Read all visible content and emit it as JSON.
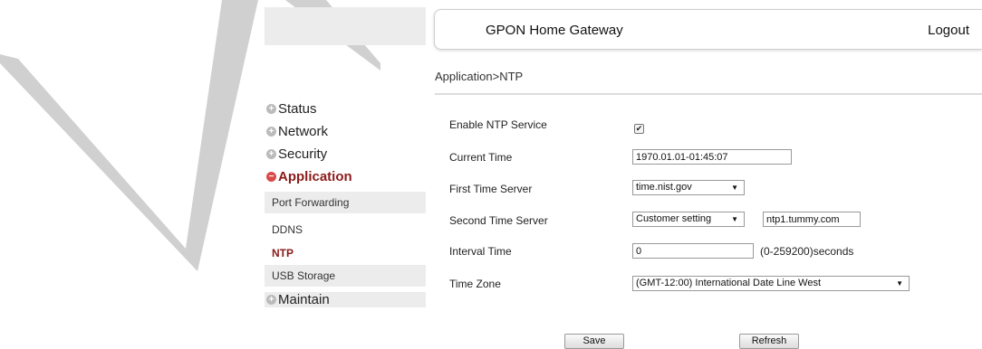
{
  "header": {
    "title": "GPON Home Gateway",
    "logout_label": "Logout"
  },
  "breadcrumb": "Application>NTP",
  "nav": {
    "status": "Status",
    "network": "Network",
    "security": "Security",
    "application": "Application",
    "maintain": "Maintain",
    "sub_items": {
      "port_forwarding": "Port Forwarding",
      "ddns": "DDNS",
      "ntp": "NTP",
      "usb_storage": "USB Storage"
    }
  },
  "form": {
    "enable_label": "Enable NTP Service",
    "enable_checked": true,
    "current_time_label": "Current Time",
    "current_time_value": "1970.01.01-01:45:07",
    "first_server_label": "First Time Server",
    "first_server_value": "time.nist.gov",
    "second_server_label": "Second Time Server",
    "second_server_value": "Customer setting",
    "second_server_custom": "ntp1.tummy.com",
    "interval_label": "Interval Time",
    "interval_value": "0",
    "interval_unit": "(0-259200)seconds",
    "timezone_label": "Time Zone",
    "timezone_value": "(GMT-12:00) International Date Line West"
  },
  "buttons": {
    "save": "Save",
    "refresh": "Refresh"
  },
  "colors": {
    "accent": "#8b1a1a",
    "nav_bg": "#ececec",
    "logo_outline": "#d0d0d0"
  }
}
